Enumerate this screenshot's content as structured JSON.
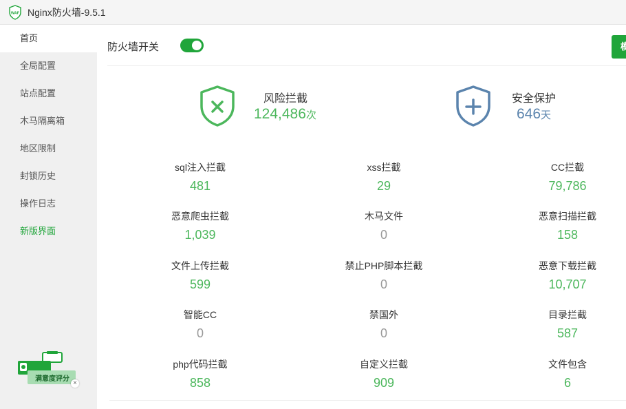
{
  "window": {
    "title": "Nginx防火墙-9.5.1",
    "logo_text": "WAF"
  },
  "sidebar": {
    "items": [
      {
        "label": "首页"
      },
      {
        "label": "全局配置"
      },
      {
        "label": "站点配置"
      },
      {
        "label": "木马隔离箱"
      },
      {
        "label": "地区限制"
      },
      {
        "label": "封锁历史"
      },
      {
        "label": "操作日志"
      },
      {
        "label": "新版界面"
      }
    ],
    "promo": {
      "text": "满意度评分",
      "close": "×"
    }
  },
  "header": {
    "toggle_label": "防火墙开关",
    "toggle_on": true,
    "sim_button": "模拟"
  },
  "summary": {
    "risk": {
      "label": "风险拦截",
      "value": "124,486",
      "unit": "次"
    },
    "protect": {
      "label": "安全保护",
      "value": "646",
      "unit": "天"
    }
  },
  "stats": [
    {
      "label": "sql注入拦截",
      "value": "481"
    },
    {
      "label": "xss拦截",
      "value": "29"
    },
    {
      "label": "CC拦截",
      "value": "79,786"
    },
    {
      "label": "恶意爬虫拦截",
      "value": "1,039"
    },
    {
      "label": "木马文件",
      "value": "0"
    },
    {
      "label": "恶意扫描拦截",
      "value": "158"
    },
    {
      "label": "文件上传拦截",
      "value": "599"
    },
    {
      "label": "禁止PHP脚本拦截",
      "value": "0"
    },
    {
      "label": "恶意下载拦截",
      "value": "10,707"
    },
    {
      "label": "智能CC",
      "value": "0"
    },
    {
      "label": "禁国外",
      "value": "0"
    },
    {
      "label": "目录拦截",
      "value": "587"
    },
    {
      "label": "php代码拦截",
      "value": "858"
    },
    {
      "label": "自定义拦截",
      "value": "909"
    },
    {
      "label": "文件包含",
      "value": "6"
    }
  ],
  "colors": {
    "accent": "#20a53a",
    "value_green": "#4cb75c",
    "protect_blue": "#5b84ad",
    "zero_gray": "#999999"
  }
}
